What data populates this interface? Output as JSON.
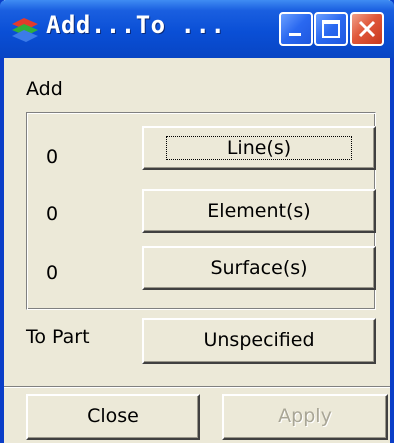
{
  "window": {
    "title": "Add...To ...",
    "colors": {
      "titlebar": "#0a4fd6",
      "close_button": "#e0583a",
      "face": "#ece9d8"
    }
  },
  "menu": {
    "add_label": "Add"
  },
  "entities": [
    {
      "count": "0",
      "button_label": "Line(s)"
    },
    {
      "count": "0",
      "button_label": "Element(s)"
    },
    {
      "count": "0",
      "button_label": "Surface(s)"
    }
  ],
  "target": {
    "label": "To Part",
    "button_label": "Unspecified"
  },
  "actions": {
    "close_label": "Close",
    "apply_label": "Apply"
  }
}
